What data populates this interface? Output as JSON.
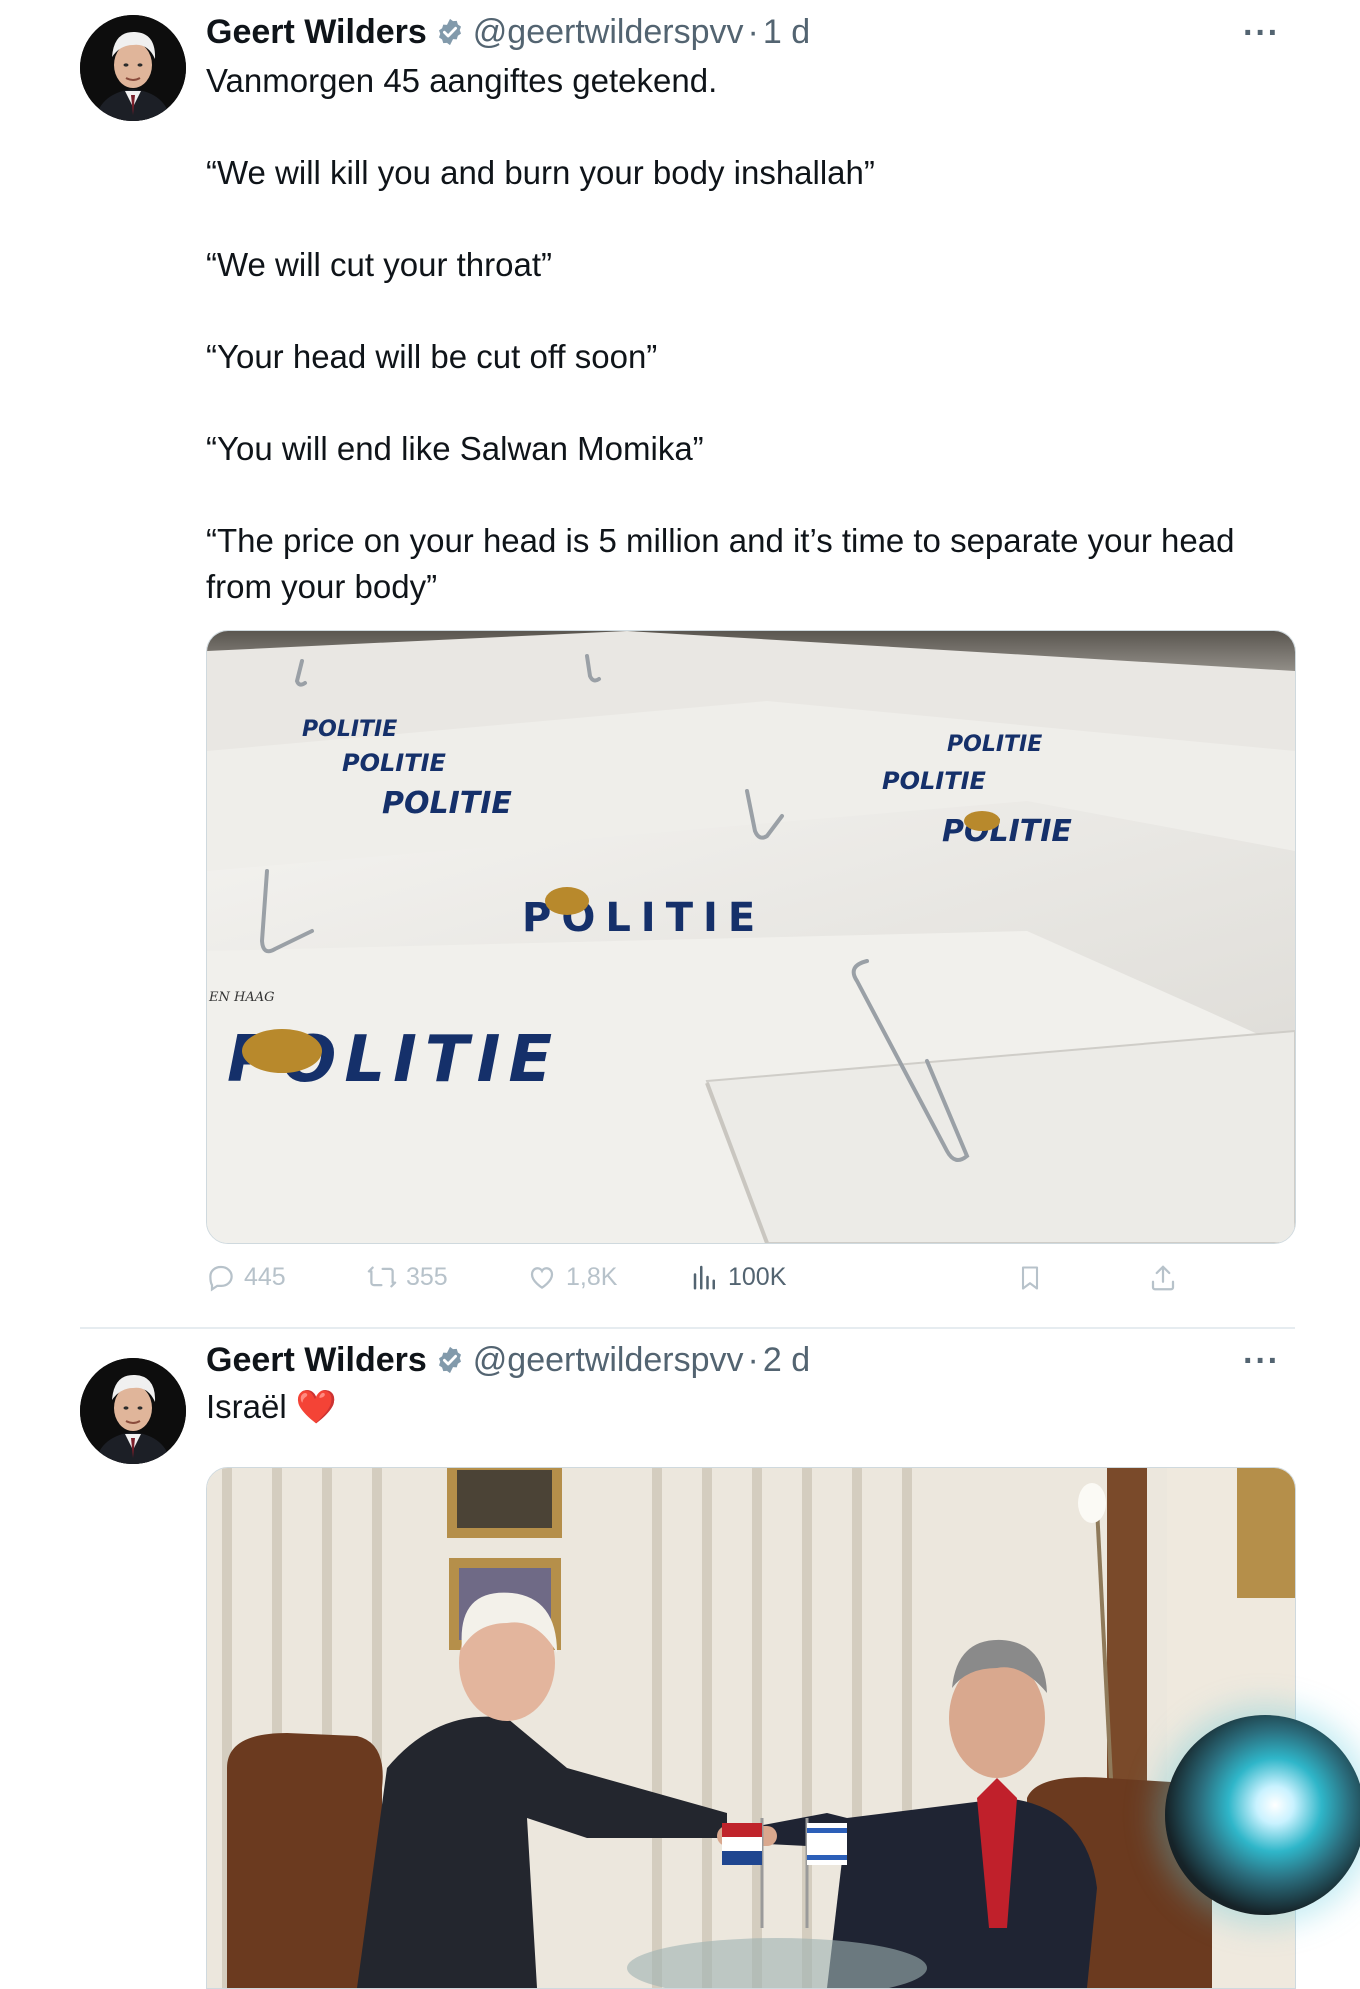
{
  "tweets": [
    {
      "author": "Geert Wilders",
      "handle": "@geertwilderspvv",
      "separator": "·",
      "time": "1 d",
      "more": "···",
      "text": "Vanmorgen 45 aangiftes getekend.\n\n“We will kill you and burn your body inshallah”\n\n“We will cut your throat”\n\n“Your head will be cut off soon”\n\n“You will end like Salwan Momika”\n\n“The price on your head is 5 million and it’s time to separate your head from your body”",
      "media_text": {
        "politie": "POLITIE",
        "haag": "EN HAAG"
      },
      "actions": {
        "replies": "445",
        "reposts": "355",
        "likes": "1,8K",
        "views": "100K"
      }
    },
    {
      "author": "Geert Wilders",
      "handle": "@geertwilderspvv",
      "separator": "·",
      "time": "2 d",
      "more": "···",
      "text": "Israël ❤️"
    }
  ],
  "colors": {
    "text": "#0f1419",
    "secondary": "#536471",
    "verified": "#829aab",
    "divider": "#e6ecf0",
    "politie_blue": "#15306a",
    "politie_gold": "#b8892c"
  },
  "icons": [
    "verified-badge-icon",
    "more-icon",
    "reply-icon",
    "repost-icon",
    "like-icon",
    "views-icon",
    "bookmark-icon",
    "share-icon",
    "heart-emoji",
    "siri-orb"
  ]
}
